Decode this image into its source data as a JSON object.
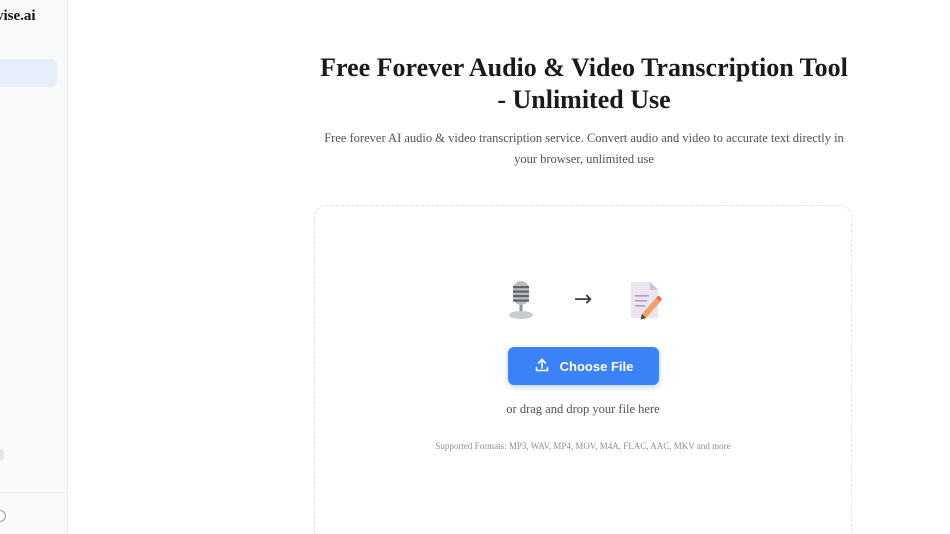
{
  "sidebar": {
    "brand": "vise.ai"
  },
  "page": {
    "title": "Free Forever Audio & Video Transcription Tool - Unlimited Use",
    "subtitle": "Free forever AI audio & video transcription service. Convert audio and video to accurate text directly in your browser, unlimited use"
  },
  "upload": {
    "icons": [
      "microphone-icon",
      "right-arrow-icon",
      "document-pencil-icon"
    ],
    "arrow_glyph": "→",
    "button_label": "Choose File",
    "drag_hint": "or drag and drop your file here",
    "formats": "Supported Formats: MP3, WAV, MP4, MOV, M4A, FLAC, AAC, MKV and more"
  },
  "colors": {
    "accent": "#3b82f6",
    "sidebar_bg": "#f9fafb",
    "active_nav": "#e6eefc"
  }
}
